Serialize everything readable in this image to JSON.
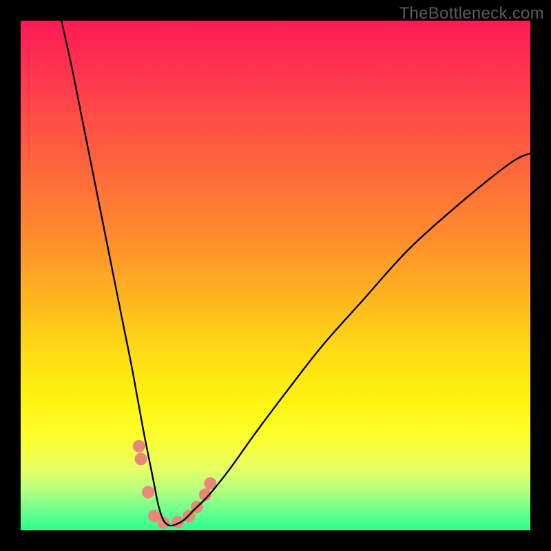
{
  "watermark": {
    "text": "TheBottleneck.com"
  },
  "chart_data": {
    "type": "line",
    "title": "",
    "xlabel": "",
    "ylabel": "",
    "xlim": [
      0,
      100
    ],
    "ylim": [
      0,
      100
    ],
    "grid": false,
    "legend": false,
    "notes": "Two black curves descending toward a shared minimum around x≈29 on a rainbow gradient background; left branch is steep, right branch shallower. A cluster of salmon dots marks the trough region. Values are estimated from the image.",
    "series": [
      {
        "name": "bottleneck-curve-left",
        "x": [
          8,
          10,
          12,
          14,
          16,
          18,
          20,
          22,
          24,
          26,
          27,
          28,
          29
        ],
        "values": [
          100,
          91,
          81,
          71,
          61,
          51,
          41,
          31,
          20,
          10,
          5,
          2,
          1
        ]
      },
      {
        "name": "bottleneck-curve-right",
        "x": [
          29,
          30,
          32,
          34,
          37,
          41,
          46,
          52,
          59,
          67,
          76,
          86,
          96,
          100
        ],
        "values": [
          1,
          1,
          2,
          4,
          7,
          12,
          19,
          27,
          36,
          45,
          55,
          64,
          72,
          74
        ]
      }
    ],
    "markers": {
      "name": "trough-dots",
      "color": "#e98779",
      "radius_px": 9,
      "points": [
        {
          "x": 23.2,
          "y": 16.5
        },
        {
          "x": 23.6,
          "y": 14.0
        },
        {
          "x": 25.0,
          "y": 7.5
        },
        {
          "x": 26.2,
          "y": 2.8
        },
        {
          "x": 28.0,
          "y": 1.5
        },
        {
          "x": 30.8,
          "y": 1.6
        },
        {
          "x": 33.0,
          "y": 2.8
        },
        {
          "x": 34.6,
          "y": 4.6
        },
        {
          "x": 36.2,
          "y": 7.0
        },
        {
          "x": 37.2,
          "y": 9.2
        }
      ]
    },
    "background": {
      "type": "vertical-gradient",
      "stops": [
        {
          "pos": 0.0,
          "hex": "#ff1a56"
        },
        {
          "pos": 0.3,
          "hex": "#ff6a3a"
        },
        {
          "pos": 0.64,
          "hex": "#ffd816"
        },
        {
          "pos": 0.82,
          "hex": "#fdff2e"
        },
        {
          "pos": 1.0,
          "hex": "#2cff8f"
        }
      ]
    }
  }
}
